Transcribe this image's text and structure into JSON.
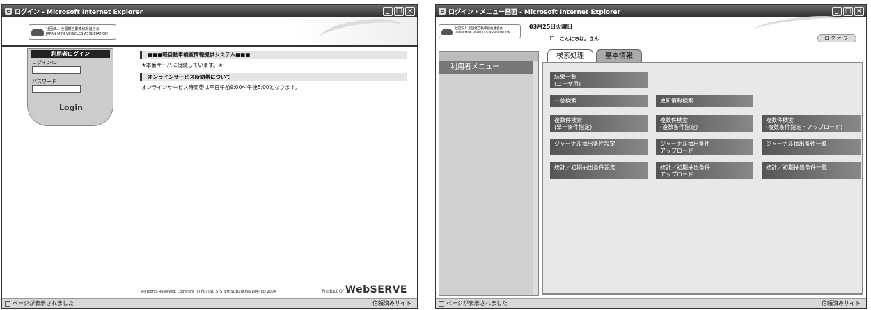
{
  "window_left": {
    "title": "ログイン - Microsoft Internet Explorer",
    "logo_text": "社団法人 全国軽自動車協会連合会\nJAPAN MINI VEHICLES ASSOCIATION",
    "login": {
      "heading": "利用者ログイン",
      "id_label": "ログインID",
      "password_label": "パスワード",
      "button": "Login"
    },
    "sections": [
      {
        "heading": "■■■軽自動車検査情報提供システム■■■",
        "text": "★本番サーバに接続しています。★"
      },
      {
        "heading": "オンラインサービス時間帯について",
        "text": "オンラインサービス時間帯は平日午前9:00～午後5:00となります。"
      }
    ],
    "copyright": "All Rights Reserved, Copyright (c) FUJITSU SYSTEM SOLUTIONS LIMITED 2004",
    "product_prefix": "Product Of",
    "product_name": "WebSERVE",
    "status_left": "ページが表示されました",
    "status_right": "信頼済みサイト"
  },
  "window_right": {
    "title": "ログイン・メニュー画面 - Microsoft Internet Explorer",
    "logo_text": "社団法人 全国軽自動車協会連合会\nJAPAN MINI VEHICLES ASSOCIATION",
    "date": "03月25日火曜日",
    "greeting": "こんにちは。さん",
    "logout": "ログオフ",
    "menu_heading": "利用者メニュー",
    "tabs": [
      {
        "label": "検索処理",
        "active": true
      },
      {
        "label": "基本情報",
        "active": false
      }
    ],
    "buttons": {
      "result_list": "結果一覧\n(ユーザ用)",
      "single_search": "一意検索",
      "update_search": "更新情報検索",
      "multi_single": "複数件検索\n(単一条件指定)",
      "multi_multi": "複数件検索\n(複数条件指定)",
      "multi_upload": "複数件検索\n(複数条件指定・アップロード)",
      "journal_setting": "ジャーナル抽出条件設定",
      "journal_upload": "ジャーナル抽出条件\nアップロード",
      "journal_list": "ジャーナル抽出条件一覧",
      "stats_setting": "統計／初期抽出条件設定",
      "stats_upload": "統計／初期抽出条件\nアップロード",
      "stats_list": "統計／初期抽出条件一覧"
    },
    "status_left": "ページが表示されました",
    "status_right": "信頼済みサイト"
  }
}
